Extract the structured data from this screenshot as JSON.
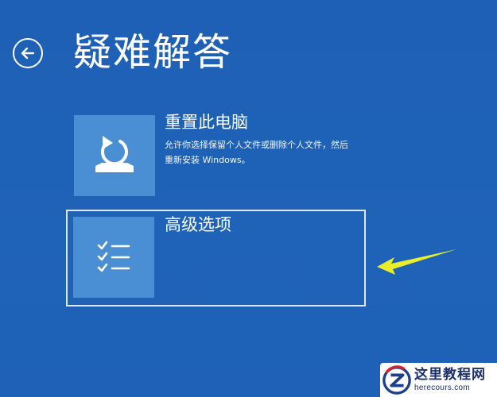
{
  "page": {
    "title": "疑难解答"
  },
  "options": [
    {
      "id": "reset",
      "title": "重置此电脑",
      "description": "允许你选择保留个人文件或删除个人文件，然后重新安装 Windows。",
      "icon": "reset-pc-icon",
      "selected": false
    },
    {
      "id": "advanced",
      "title": "高级选项",
      "description": "",
      "icon": "checklist-icon",
      "selected": true
    }
  ],
  "watermark": {
    "name": "这里教程网",
    "domain": "herecours.com"
  },
  "colors": {
    "background": "#1f62b8",
    "tile": "#4a8fd3",
    "arrow": "#e8ee2a",
    "selection_border": "#dfe9f6"
  }
}
